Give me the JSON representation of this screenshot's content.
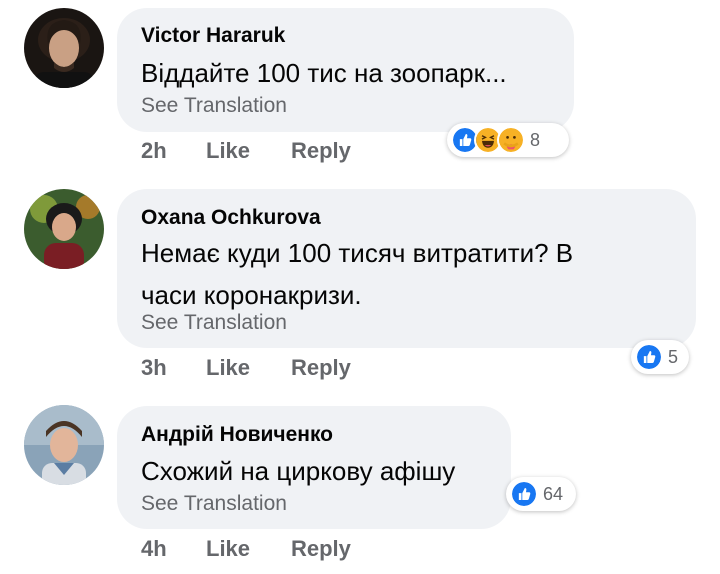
{
  "comments": [
    {
      "author": "Victor Hararuk",
      "text_lines": [
        "Віддайте 100 тис на зоопарк..."
      ],
      "translate_label": "See Translation",
      "time": "2h",
      "like_label": "Like",
      "reply_label": "Reply",
      "reactions": {
        "icons": [
          "like-icon",
          "haha-icon",
          "care-icon"
        ],
        "count": "8"
      }
    },
    {
      "author": "Oxana Ochkurova",
      "text_lines": [
        "Немає куди 100 тисяч витратити? В",
        "часи коронакризи."
      ],
      "translate_label": "See Translation",
      "time": "3h",
      "like_label": "Like",
      "reply_label": "Reply",
      "reactions": {
        "icons": [
          "like-icon"
        ],
        "count": "5"
      }
    },
    {
      "author": "Андрій Новиченко",
      "text_lines": [
        "Схожий на циркову афішу"
      ],
      "translate_label": "See Translation",
      "time": "4h",
      "like_label": "Like",
      "reply_label": "Reply",
      "reactions": {
        "icons": [
          "like-icon"
        ],
        "count": "64"
      }
    }
  ],
  "colors": {
    "bubble": "#f0f2f5",
    "secondary_text": "#65676b",
    "like_blue": "#1877f2",
    "haha_yellow": "#f7b125"
  }
}
